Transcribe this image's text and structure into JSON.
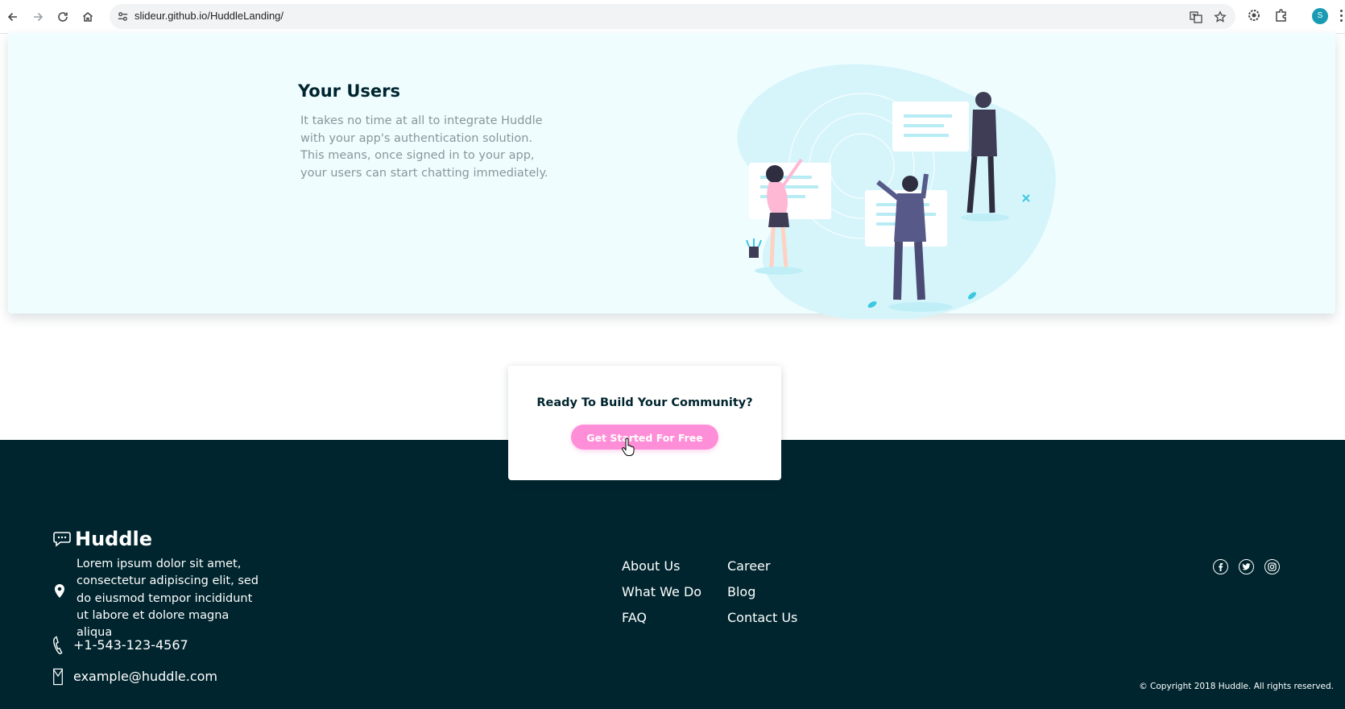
{
  "browser": {
    "url": "slideur.github.io/HuddleLanding/",
    "profile_initial": "S",
    "icons": [
      "back-icon",
      "forward-icon",
      "reload-icon",
      "home-icon",
      "site-info-icon",
      "translate-icon",
      "bookmark-star-icon",
      "extension-puzzle-icon",
      "profile-avatar"
    ]
  },
  "feature": {
    "title": "Your Users",
    "text": "It takes no time at all to integrate Huddle with your app's authentication solution. This means, once signed in to your app, your users can start chatting immediately."
  },
  "cta": {
    "title": "Ready To Build Your Community?",
    "button_label": "Get Started For Free"
  },
  "footer": {
    "brand": "Huddle",
    "address": "Lorem ipsum dolor sit amet, consectetur adipiscing elit, sed do eiusmod tempor incididunt ut labore et dolore magna aliqua",
    "phone": "+1-543-123-4567",
    "email": "example@huddle.com",
    "links": {
      "about": "About Us",
      "career": "Career",
      "what_we_do": "What We Do",
      "blog": "Blog",
      "faq": "FAQ",
      "contact": "Contact Us"
    },
    "socials": [
      "facebook-icon",
      "twitter-icon",
      "instagram-icon"
    ],
    "copyright": "© Copyright 2018 Huddle. All rights reserved."
  },
  "colors": {
    "footer_bg": "#00252e",
    "feature_bg": "#f0fdff",
    "cta_button": "#ff8ed8",
    "accent_teal": "#1a9bb4"
  }
}
